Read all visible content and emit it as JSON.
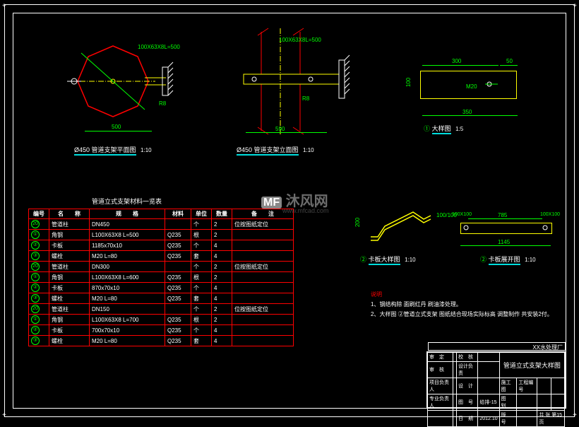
{
  "drawings": {
    "view1": {
      "title": "Ø450 管道支架平面图",
      "scale": "1:10"
    },
    "view2": {
      "title": "Ø450 管道支架立面图",
      "scale": "1:10"
    },
    "view3": {
      "title": "大样图",
      "scale": "1:5",
      "circle": "①"
    },
    "view4": {
      "title": "卡板大样图",
      "scale": "1:10",
      "circle": "②"
    },
    "view5": {
      "title": "卡板展开图",
      "scale": "1:10",
      "circle": "②"
    }
  },
  "dimensions": {
    "view1_main": "500",
    "view1_angle": "100X63X8L=500",
    "view1_r": "8",
    "view2_main": "590",
    "view2_angle": "100X63X8L=500",
    "view2_r": "8",
    "view3_w": "300",
    "view3_w2": "50",
    "view3_w3": "350",
    "view3_h": "100",
    "view3_bolt": "M20",
    "view4_h": "200",
    "view4_angle": "100/100",
    "view5_w1": "785",
    "view5_w2": "1145",
    "view5_end": "100X100",
    "view5_end2": "100X100"
  },
  "table": {
    "title": "管道立式支架材料一览表",
    "headers": [
      "编号",
      "名　　称",
      "规　　格",
      "材料",
      "单位",
      "数量",
      "备　　注"
    ],
    "rows": [
      {
        "n": "20",
        "name": "管道柱",
        "spec": "DN450",
        "mat": "",
        "unit": "个",
        "qty": "2",
        "note": "位按图纸定位"
      },
      {
        "n": "①",
        "name": "角钢",
        "spec": "L100X63X8 L=500",
        "mat": "Q235",
        "unit": "根",
        "qty": "2",
        "note": ""
      },
      {
        "n": "②",
        "name": "卡板",
        "spec": "1185x70x10",
        "mat": "Q235",
        "unit": "个",
        "qty": "4",
        "note": ""
      },
      {
        "n": "③",
        "name": "螺栓",
        "spec": "M20 L=80",
        "mat": "Q235",
        "unit": "套",
        "qty": "4",
        "note": ""
      },
      {
        "n": "20",
        "name": "管道柱",
        "spec": "DN300",
        "mat": "",
        "unit": "个",
        "qty": "2",
        "note": "位按图纸定位"
      },
      {
        "n": "①",
        "name": "角钢",
        "spec": "L100X63X8 L=600",
        "mat": "Q235",
        "unit": "根",
        "qty": "2",
        "note": ""
      },
      {
        "n": "②",
        "name": "卡板",
        "spec": "870x70x10",
        "mat": "Q235",
        "unit": "个",
        "qty": "4",
        "note": ""
      },
      {
        "n": "③",
        "name": "螺栓",
        "spec": "M20 L=80",
        "mat": "Q235",
        "unit": "套",
        "qty": "4",
        "note": ""
      },
      {
        "n": "20",
        "name": "管道柱",
        "spec": "DN150",
        "mat": "",
        "unit": "个",
        "qty": "2",
        "note": "位按图纸定位"
      },
      {
        "n": "①",
        "name": "角钢",
        "spec": "L100X63X8 L=700",
        "mat": "Q235",
        "unit": "根",
        "qty": "2",
        "note": ""
      },
      {
        "n": "②",
        "name": "卡板",
        "spec": "700x70x10",
        "mat": "Q235",
        "unit": "个",
        "qty": "4",
        "note": ""
      },
      {
        "n": "③",
        "name": "螺栓",
        "spec": "M20 L=80",
        "mat": "Q235",
        "unit": "套",
        "qty": "4",
        "note": ""
      }
    ]
  },
  "notes": {
    "header": "说明",
    "n1": "1、钢结构除 面刷红丹 刷油漆处理。",
    "n2": "2、大样图 ②管道立式支架 图纸结合现场实际标高 调整制作 共安装2付。"
  },
  "titleblock": {
    "factory": "XX水处理厂",
    "drawing_title": "管道立式支架大样图",
    "r1c1": "审　定",
    "r1c3": "校　核",
    "r2c1": "审　核",
    "r2c3": "设计负责",
    "r2c5": "施工图",
    "r2c6": "工程编号",
    "r3c1": "项目负责人",
    "r3c3": "设　计",
    "r3c5": "图　号",
    "r3c6": "给排-15",
    "r3c7": "图　别",
    "r4c1": "专业负责人",
    "r4c3": "日　期",
    "r4c4": "2012.10",
    "r4c5": "版　号",
    "r4c6": "共 张 第15页"
  },
  "watermark": {
    "main": "沐风网",
    "sub": "www.mfcad.com",
    "logo": "MF"
  }
}
